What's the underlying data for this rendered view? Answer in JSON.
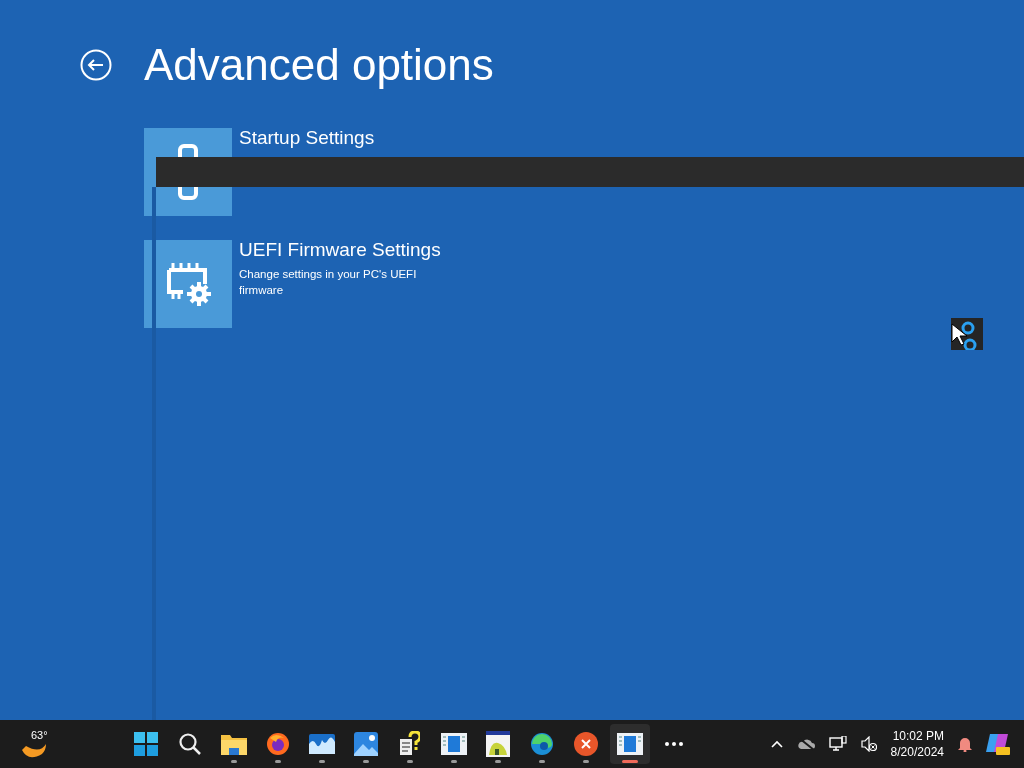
{
  "title": "Advanced options",
  "options": [
    {
      "kind": "startup",
      "title": "Startup Settings"
    },
    {
      "kind": "firmware",
      "title": "UEFI Firmware Settings",
      "description": "Change settings in your PC's UEFI firmware"
    }
  ],
  "taskbar": {
    "weather": {
      "temperature": "63°"
    },
    "apps": [
      {
        "kind": "start",
        "running": false,
        "selected": false
      },
      {
        "kind": "search",
        "running": false,
        "selected": false
      },
      {
        "kind": "folder",
        "running": true,
        "selected": false
      },
      {
        "kind": "browser-fox",
        "running": true,
        "selected": false
      },
      {
        "kind": "wave",
        "running": true,
        "selected": false
      },
      {
        "kind": "photos",
        "running": true,
        "selected": false
      },
      {
        "kind": "help",
        "running": true,
        "selected": false
      },
      {
        "kind": "window",
        "running": true,
        "selected": false
      },
      {
        "kind": "painter",
        "running": true,
        "selected": false
      },
      {
        "kind": "browser-edge",
        "running": true,
        "selected": false
      },
      {
        "kind": "close-app",
        "running": true,
        "selected": false
      },
      {
        "kind": "window",
        "running": true,
        "selected": true
      },
      {
        "kind": "more",
        "running": false,
        "selected": false
      }
    ],
    "clock": {
      "time": "10:02 PM",
      "date": "8/20/2024"
    }
  }
}
